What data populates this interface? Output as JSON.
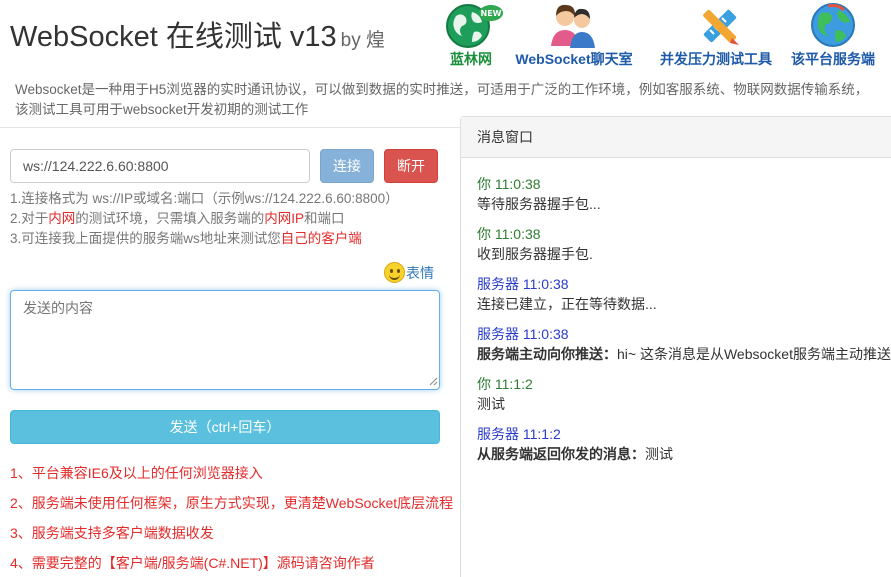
{
  "header": {
    "title": "WebSocket 在线测试 v13",
    "by": "by 煌"
  },
  "nav": [
    {
      "label": "蓝林网",
      "icon": "globe-new-icon"
    },
    {
      "label": "WebSocket聊天室",
      "icon": "chat-users-icon"
    },
    {
      "label": "并发压力测试工具",
      "icon": "pencil-ruler-icon"
    },
    {
      "label": "该平台服务端",
      "icon": "globe-icon"
    }
  ],
  "new_badge": "NEW",
  "description": {
    "line1": "Websocket是一种用于H5浏览器的实时通讯协议，可以做到数据的实时推送，可适用于广泛的工作环境，例如客服系统、物联网数据传输系统，",
    "line2": "该测试工具可用于websocket开发初期的测试工作"
  },
  "connection": {
    "url": "ws://124.222.6.60:8800",
    "connect_label": "连接",
    "disconnect_label": "断开"
  },
  "tips": {
    "t1": "1.连接格式为 ws://IP或域名:端口（示例ws://124.222.6.60:8800）",
    "t2a": "2.对于",
    "t2b": "内网",
    "t2c": "的测试环境，只需填入服务端的",
    "t2d": "内网IP",
    "t2e": "和端口",
    "t3a": "3.可连接我上面提供的服务端ws地址来测试您",
    "t3b": "自己的客户端"
  },
  "emoji_label": "表情",
  "send": {
    "placeholder": "发送的内容",
    "button_label": "发送（ctrl+回车）"
  },
  "features": [
    "1、平台兼容IE6及以上的任何浏览器接入",
    "2、服务端未使用任何框架，原生方式实现，更清楚WebSocket底层流程",
    "3、服务端支持多客户端数据收发",
    "4、需要完整的【客户端/服务端(C#.NET)】源码请咨询作者"
  ],
  "messages_panel": {
    "title": "消息窗口",
    "messages": [
      {
        "from": "你 11:0:38",
        "text": "等待服务器握手包..."
      },
      {
        "from": "你 11:0:38",
        "text": "收到服务器握手包."
      },
      {
        "from": "服务器 11:0:38",
        "text": "连接已建立，正在等待数据..."
      },
      {
        "from": "服务器 11:0:38",
        "bold": "服务端主动向你推送：",
        "text": "hi~ 这条消息是从Websocket服务端主动推送"
      },
      {
        "from": "你 11:1:2",
        "text": "测试"
      },
      {
        "from": "服务器 11:1:2",
        "bold": "从服务端返回你发的消息：",
        "text": "测试"
      }
    ]
  },
  "colors": {
    "client": "#2e7d32",
    "server": "#2a3cc8",
    "danger": "#d9534f",
    "info": "#5bc0de",
    "highlight": "#e42b2b"
  }
}
